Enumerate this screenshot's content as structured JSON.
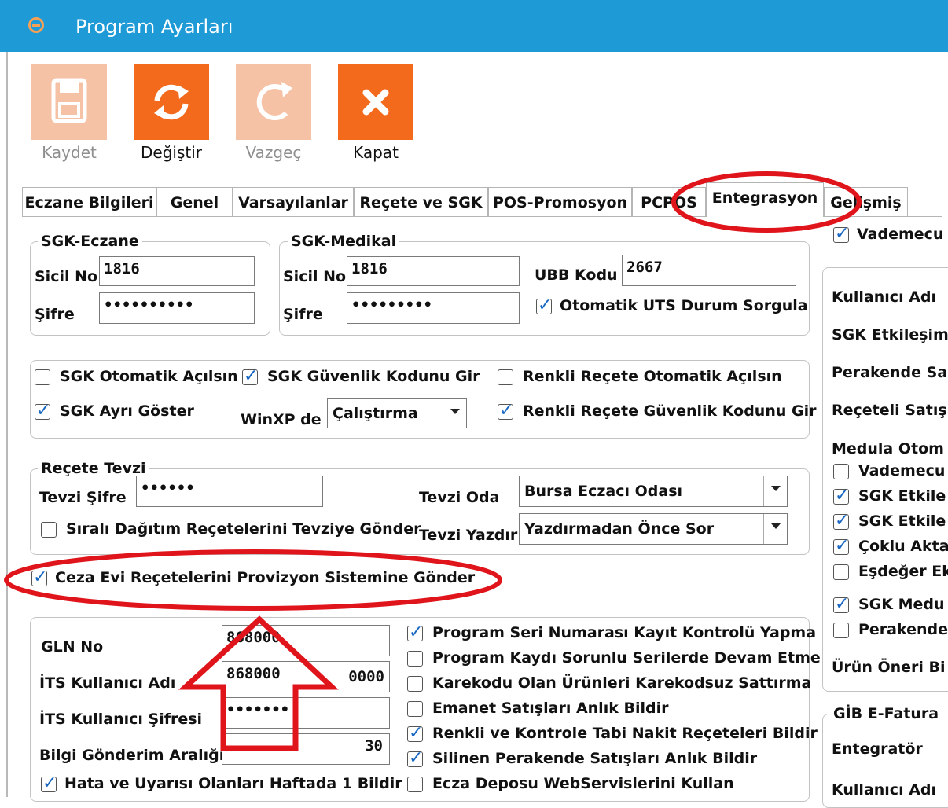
{
  "window": {
    "title": "Program Ayarları"
  },
  "toolbar": {
    "save_label": "Kaydet",
    "change_label": "Değiştir",
    "cancel_label": "Vazgeç",
    "close_label": "Kapat",
    "colors": {
      "active": "#f36a1c",
      "disabled": "#f6c2a5"
    }
  },
  "tabs": [
    {
      "label": "Eczane Bilgileri"
    },
    {
      "label": "Genel"
    },
    {
      "label": "Varsayılanlar"
    },
    {
      "label": "Reçete ve SGK"
    },
    {
      "label": "POS-Promosyon"
    },
    {
      "label": "PCPOS"
    },
    {
      "label": "Entegrasyon",
      "active": true
    },
    {
      "label": "Gelişmiş"
    }
  ],
  "sgk_eczane": {
    "legend": "SGK-Eczane",
    "sicil_label": "Sicil No",
    "sicil_value": "1816",
    "sifre_label": "Şifre",
    "sifre_value": "••••••••••"
  },
  "sgk_medikal": {
    "legend": "SGK-Medikal",
    "sicil_label": "Sicil No",
    "sicil_value": "1816",
    "sifre_label": "Şifre",
    "sifre_value": "•••••••••",
    "ubb_label": "UBB Kodu",
    "ubb_value": "2667",
    "uts_label": "Otomatik UTS Durum Sorgula",
    "uts_checked": true
  },
  "options": {
    "sgk_auto_open": "SGK Otomatik Açılsın",
    "sgk_security": "SGK Güvenlik Kodunu Gir",
    "colored_auto": "Renkli Reçete Otomatik Açılsın",
    "sgk_separate": "SGK Ayrı Göster",
    "winxp_label": "WinXP de",
    "winxp_value": "Çalıştırma",
    "colored_security": "Renkli Reçete Güvenlik Kodunu Gir"
  },
  "tevzi": {
    "legend": "Reçete Tevzi",
    "sifre_label": "Tevzi Şifre",
    "sifre_value": "••••••",
    "oda_label": "Tevzi Oda",
    "oda_value": "Bursa Eczacı Odası",
    "yazdir_label": "Tevzi Yazdır",
    "yazdir_value": "Yazdırmadan Önce Sor",
    "sirali_label": "Sıralı Dağıtım Reçetelerini Tevziye Gönder"
  },
  "ceza_evi": {
    "label": "Ceza Evi Reçetelerini Provizyon Sistemine Gönder",
    "checked": true
  },
  "its": {
    "gln_label": "GLN No",
    "gln_value": "868000",
    "user_label": "İTS Kullanıcı Adı",
    "user_value": "868000",
    "user_tail": "0000",
    "pass_label": "İTS Kullanıcı Şifresi",
    "pass_value": "•••••••",
    "interval_label": "Bilgi Gönderim Aralığı",
    "interval_value": "30",
    "weekly_label": "Hata ve Uyarısı Olanları Haftada 1 Bildir"
  },
  "right_checks": [
    {
      "label": "Program Seri Numarası Kayıt Kontrolü Yapma",
      "checked": true
    },
    {
      "label": "Program Kaydı Sorunlu Serilerde Devam Etme",
      "checked": false
    },
    {
      "label": "Karekodu Olan Ürünleri Karekodsuz Sattırma",
      "checked": false
    },
    {
      "label": "Emanet Satışları Anlık Bildir",
      "checked": false
    },
    {
      "label": "Renkli ve Kontrole Tabi Nakit Reçeteleri Bildir",
      "checked": true
    },
    {
      "label": "Silinen Perakende Satışları Anlık Bildir",
      "checked": true
    },
    {
      "label": "Ecza Deposu WebServislerini Kullan",
      "checked": false
    }
  ],
  "side_panel": {
    "vademecum": "Vademecu",
    "labels": [
      "Kullanıcı Adı",
      "SGK Etkileşim",
      "Perakende Sa",
      "Reçeteli Satış",
      "Medula Otom"
    ],
    "checks": [
      {
        "label": "Vademecu",
        "checked": false
      },
      {
        "label": "SGK Etkile",
        "checked": true
      },
      {
        "label": "SGK Etkile",
        "checked": true
      },
      {
        "label": "Çoklu Akta",
        "checked": true
      },
      {
        "label": "Eşdeğer Ek",
        "checked": false
      },
      {
        "label": "SGK Medu",
        "checked": true
      },
      {
        "label": "Perakende",
        "checked": false
      }
    ],
    "urun_oneri": "Ürün Öneri Bi",
    "gib_legend": "GİB E-Fatura",
    "entegrator": "Entegratör",
    "kullanici": "Kullanıcı Adı"
  }
}
